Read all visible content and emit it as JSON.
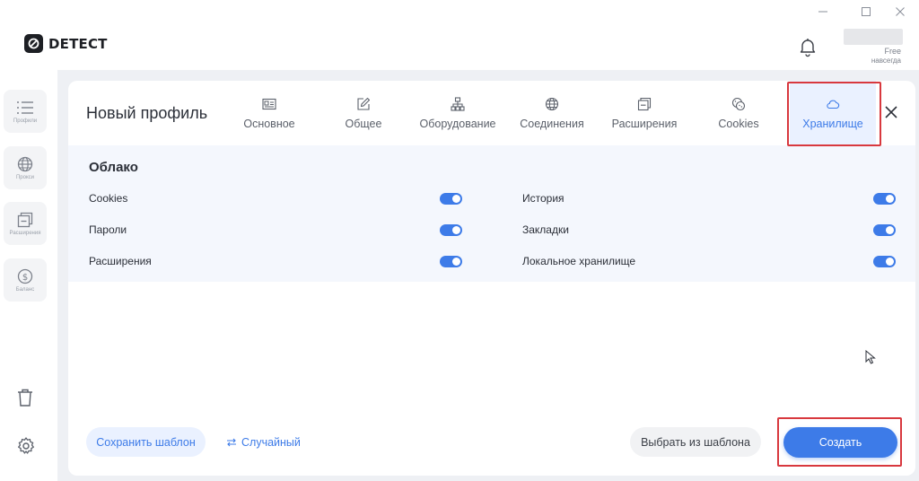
{
  "app": {
    "logo_text": "DETECT",
    "plan": {
      "line1": "Free",
      "line2": "навсегда"
    }
  },
  "sidebar": {
    "items": [
      {
        "label": "Профили",
        "icon": "list-icon"
      },
      {
        "label": "Прокси",
        "icon": "globe-icon"
      },
      {
        "label": "Расширения",
        "icon": "extensions-icon"
      },
      {
        "label": "Баланс",
        "icon": "dollar-icon"
      }
    ],
    "bottom_icons": [
      "trash-icon",
      "gear-icon"
    ]
  },
  "panel": {
    "title": "Новый профиль",
    "tabs": [
      {
        "label": "Основное",
        "icon": "id-card-icon",
        "active": false
      },
      {
        "label": "Общее",
        "icon": "edit-icon",
        "active": false
      },
      {
        "label": "Оборудование",
        "icon": "hierarchy-icon",
        "active": false
      },
      {
        "label": "Соединения",
        "icon": "globe-icon",
        "active": false
      },
      {
        "label": "Расширения",
        "icon": "extensions-icon",
        "active": false
      },
      {
        "label": "Cookies",
        "icon": "cookie-icon",
        "active": false
      },
      {
        "label": "Хранилище",
        "icon": "cloud-icon",
        "active": true
      }
    ]
  },
  "cloud": {
    "title": "Облако",
    "left_options": [
      {
        "label": "Cookies",
        "enabled": true
      },
      {
        "label": "Пароли",
        "enabled": true
      },
      {
        "label": "Расширения",
        "enabled": true
      }
    ],
    "right_options": [
      {
        "label": "История",
        "enabled": true
      },
      {
        "label": "Закладки",
        "enabled": true
      },
      {
        "label": "Локальное хранилище",
        "enabled": true
      }
    ]
  },
  "footer": {
    "save_template": "Сохранить шаблон",
    "random": "Случайный",
    "from_template": "Выбрать из шаблона",
    "create": "Создать"
  },
  "colors": {
    "accent": "#3d7be8",
    "highlight": "#d8383e",
    "active_tab_bg": "#eaf1ff"
  }
}
